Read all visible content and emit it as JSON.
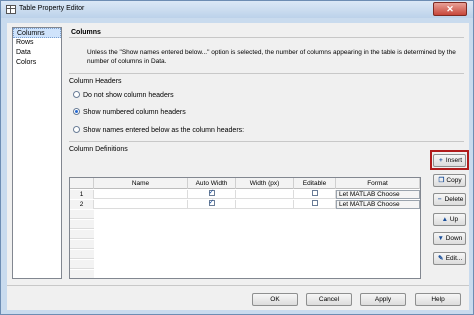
{
  "window": {
    "title": "Table Property Editor",
    "close_glyph": "✕"
  },
  "nav": {
    "items": [
      "Columns",
      "Rows",
      "Data",
      "Colors"
    ],
    "selected": "Columns"
  },
  "panel": {
    "header": "Columns",
    "note": "Unless the \"Show names entered below...\" option is selected, the number of columns appearing in the table is determined by the number of columns in Data.",
    "column_headers_label": "Column Headers",
    "radios": [
      {
        "label": "Do not show column headers",
        "checked": false
      },
      {
        "label": "Show numbered column headers",
        "checked": true
      },
      {
        "label": "Show names entered below as the column headers:",
        "checked": false
      }
    ],
    "column_definitions_label": "Column Definitions"
  },
  "table": {
    "headers": [
      "Name",
      "Auto Width",
      "Width (px)",
      "Editable",
      "Format"
    ],
    "rows": [
      {
        "num": "1",
        "name": "",
        "auto_width": true,
        "width": "",
        "editable": false,
        "format": "Let MATLAB Choose"
      },
      {
        "num": "2",
        "name": "",
        "auto_width": true,
        "width": "",
        "editable": false,
        "format": "Let MATLAB Choose"
      }
    ]
  },
  "side_buttons": [
    {
      "label": "Insert",
      "icon": "plus-icon",
      "glyph": "+"
    },
    {
      "label": "Copy",
      "icon": "copy-icon",
      "glyph": "❐"
    },
    {
      "label": "Delete",
      "icon": "minus-icon",
      "glyph": "−"
    },
    {
      "label": "Up",
      "icon": "arrow-up-icon",
      "glyph": "▲"
    },
    {
      "label": "Down",
      "icon": "arrow-down-icon",
      "glyph": "▼"
    },
    {
      "label": "Edit...",
      "icon": "edit-icon",
      "glyph": "✎"
    }
  ],
  "dialog_buttons": {
    "ok": "OK",
    "cancel": "Cancel",
    "apply": "Apply",
    "help": "Help"
  },
  "colors": {
    "highlight": "#b01b1b",
    "selection": "#cfe3fb",
    "frame": "#c9dbee"
  }
}
